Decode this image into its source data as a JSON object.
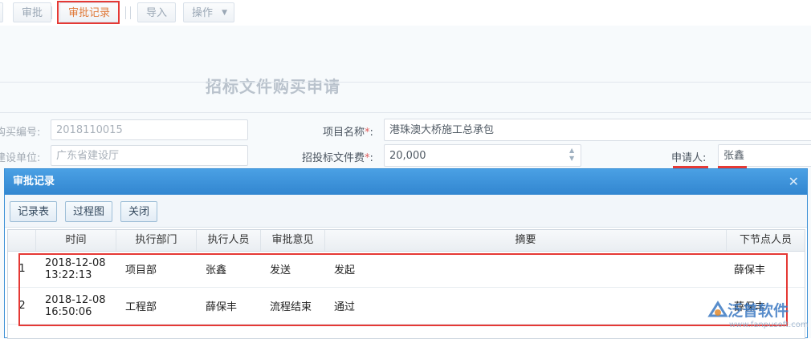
{
  "toolbar": {
    "approve_label": "审批",
    "approval_record_label": "审批记录",
    "import_label": "导入",
    "operate_label": "操作"
  },
  "form": {
    "title": "招标文件购买申请",
    "purchase_no_label": "购买编号:",
    "purchase_no_value": "2018110015",
    "project_name_label": "项目名称",
    "project_name_value": "港珠澳大桥施工总承包",
    "build_unit_label": "建设单位:",
    "build_unit_value": "广东省建设厅",
    "fee_label": "招投标文件费",
    "fee_value": "20,000",
    "applicant_label": "申请人:",
    "applicant_value": "张鑫",
    "required_mark": "*",
    "label_colon": ":"
  },
  "dialog": {
    "title": "审批记录",
    "close_glyph": "✕",
    "buttons": {
      "record_table": "记录表",
      "process_chart": "过程图",
      "close": "关闭"
    },
    "columns": [
      "时间",
      "执行部门",
      "执行人员",
      "审批意见",
      "摘要",
      "下节点人员"
    ],
    "rows": [
      {
        "no": "1",
        "date": "2018-12-08",
        "time": "13:22:13",
        "dept": "项目部",
        "person": "张鑫",
        "opinion": "发送",
        "summary": "发起",
        "next": "薛保丰"
      },
      {
        "no": "2",
        "date": "2018-12-08",
        "time": "16:50:06",
        "dept": "工程部",
        "person": "薛保丰",
        "opinion": "流程结束",
        "summary": "通过",
        "next": "薛保丰"
      }
    ]
  },
  "watermark": {
    "name": "泛普软件",
    "url": "www.fanpusoft.com"
  },
  "colors": {
    "accent": "#3a8fd6",
    "highlight": "#e53935"
  }
}
